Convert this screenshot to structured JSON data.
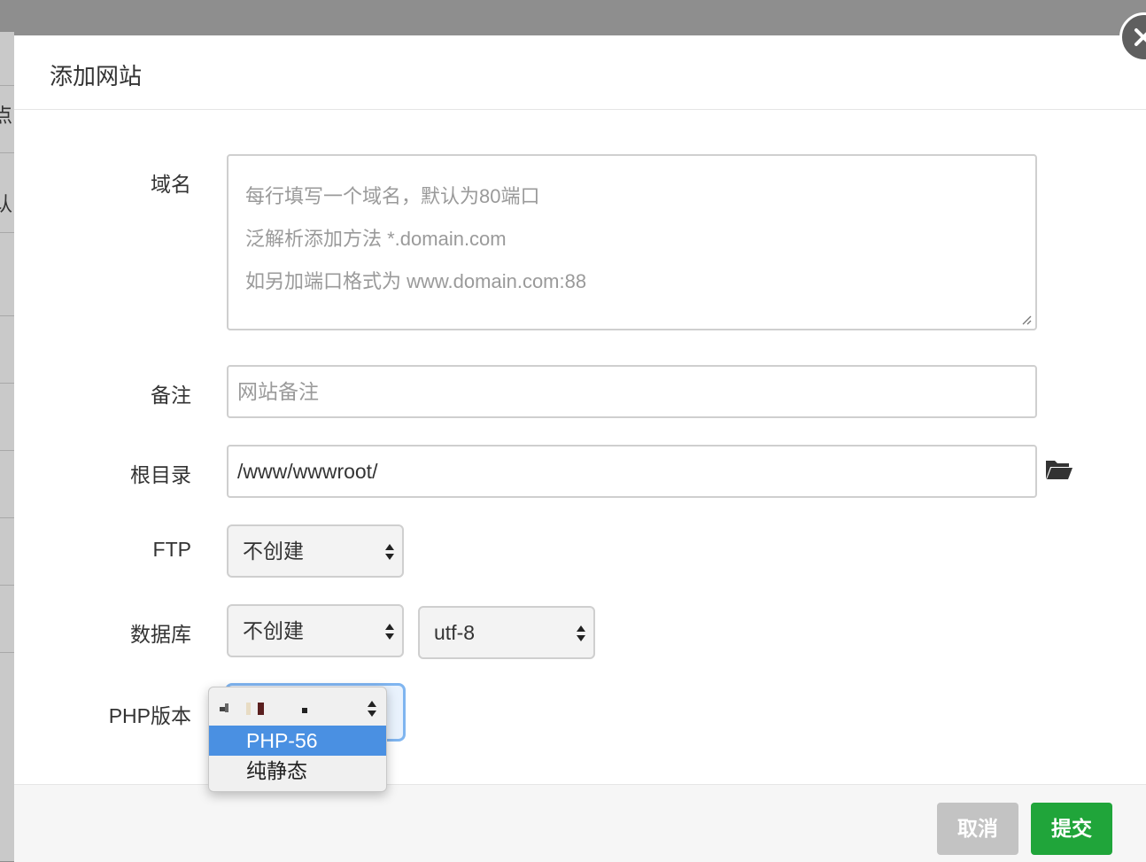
{
  "dialog": {
    "title": "添加网站",
    "close_icon": "close-x-icon"
  },
  "backdrop": {
    "fragments": [
      "点",
      "认"
    ]
  },
  "form": {
    "domain": {
      "label": "域名",
      "placeholder_lines": [
        "每行填写一个域名，默认为80端口",
        "泛解析添加方法 *.domain.com",
        "如另加端口格式为 www.domain.com:88"
      ]
    },
    "remark": {
      "label": "备注",
      "placeholder": "网站备注"
    },
    "root": {
      "label": "根目录",
      "value": "/www/wwwroot/",
      "icon": "folder-open-icon"
    },
    "ftp": {
      "label": "FTP",
      "selected": "不创建"
    },
    "database": {
      "label": "数据库",
      "selected": "不创建",
      "charset": "utf-8"
    },
    "php": {
      "label": "PHP版本",
      "options": [
        "PHP-56",
        "纯静态"
      ],
      "highlighted": "PHP-56"
    }
  },
  "footer": {
    "cancel_label": "取消",
    "submit_label": "提交"
  },
  "colors": {
    "submit": "#20a53a",
    "cancel": "#c3c3c3",
    "highlight": "#4a90e2"
  }
}
